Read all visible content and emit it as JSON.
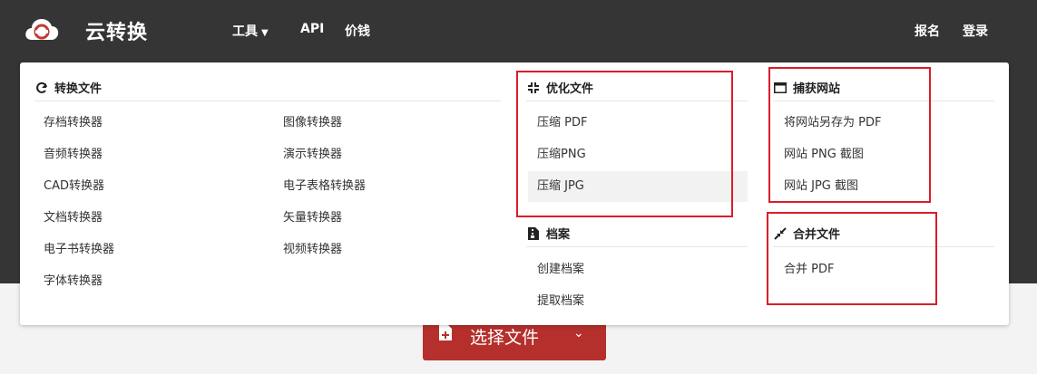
{
  "header": {
    "brand": "云转换",
    "nav": [
      {
        "label": "工具",
        "caret": "▼"
      },
      {
        "label": "API"
      },
      {
        "label": "价钱"
      }
    ],
    "right": [
      {
        "label": "报名"
      },
      {
        "label": "登录"
      }
    ]
  },
  "menu": {
    "convert": {
      "title": "转换文件",
      "col1": [
        "存档转换器",
        "音频转换器",
        "CAD转换器",
        "文档转换器",
        "电子书转换器",
        "字体转换器"
      ],
      "col2": [
        "图像转换器",
        "演示转换器",
        "电子表格转换器",
        "矢量转换器",
        "视频转换器"
      ]
    },
    "optimize": {
      "title": "优化文件",
      "items": [
        "压缩 PDF",
        "压缩PNG",
        "压缩 JPG"
      ]
    },
    "archive": {
      "title": "档案",
      "items": [
        "创建档案",
        "提取档案"
      ]
    },
    "capture": {
      "title": "捕获网站",
      "items": [
        "将网站另存为 PDF",
        "网站 PNG 截图",
        "网站 JPG 截图"
      ]
    },
    "merge": {
      "title": "合并文件",
      "items": [
        "合并 PDF"
      ]
    }
  },
  "select_button": {
    "label": "选择文件",
    "chevron": "⌄"
  },
  "colors": {
    "header_bg": "#353535",
    "accent_red": "#b5302c",
    "highlight_box": "#d81e2a"
  }
}
